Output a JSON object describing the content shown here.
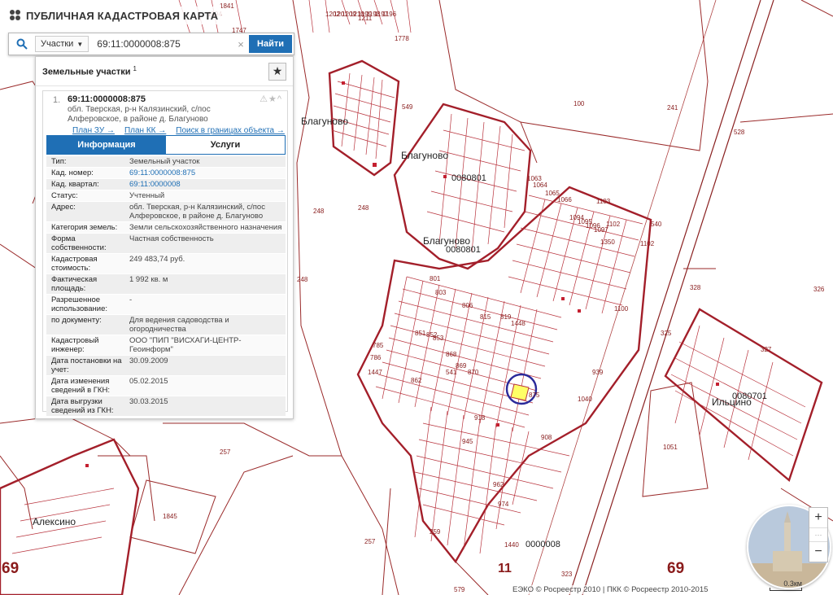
{
  "header": {
    "title": "ПУБЛИЧНАЯ КАДАСТРОВАЯ КАРТА"
  },
  "search": {
    "dropdown_label": "Участки",
    "query": "69:11:0000008:875",
    "clear_symbol": "×",
    "find_label": "Найти"
  },
  "panel": {
    "title": "Земельные участки",
    "count": "1",
    "result": {
      "index": "1.",
      "cad_number": "69:11:0000008:875",
      "address_line1": "обл. Тверская, р-н Калязинский, с/пос",
      "address_line2": "Алферовское, в районе д. Благуново",
      "tools": "⚠★^",
      "links": [
        "План ЗУ →",
        "План КК →",
        "Поиск в границах объекта →"
      ]
    },
    "tabs": [
      {
        "label": "Информация",
        "active": true
      },
      {
        "label": "Услуги",
        "active": false
      }
    ],
    "rows": [
      {
        "key": "Тип:",
        "value": "Земельный участок"
      },
      {
        "key": "Кад. номер:",
        "value": "69:11:0000008:875"
      },
      {
        "key": "Кад. квартал:",
        "value": "69:11:0000008"
      },
      {
        "key": "Статус:",
        "value": "Учтенный"
      },
      {
        "key": "Адрес:",
        "value": "обл. Тверская, р-н Калязинский, с/пос Алферовское, в районе д. Благуново"
      },
      {
        "key": "Категория земель:",
        "value": "Земли сельскохозяйственного назначения"
      },
      {
        "key": "Форма собственности:",
        "value": "Частная собственность"
      },
      {
        "key": "Кадастровая стоимость:",
        "value": "249 483,74 руб."
      },
      {
        "key": "Фактическая площадь:",
        "value": "1 992 кв. м"
      },
      {
        "key": "Разрешенное использование:",
        "value": "-"
      },
      {
        "key": "по документу:",
        "value": "Для ведения садоводства и огородничества"
      },
      {
        "key": "Кадастровый инженер:",
        "value": "ООО \"ПИП \"ВИСХАГИ-ЦЕНТР-Геоинформ\""
      },
      {
        "key": "Дата постановки на учет:",
        "value": "30.09.2009"
      },
      {
        "key": "Дата изменения сведений в ГКН:",
        "value": "05.02.2015"
      },
      {
        "key": "Дата выгрузки сведений из ГКН:",
        "value": "30.03.2015"
      }
    ]
  },
  "map": {
    "labels": {
      "blagunovo_1": "Благуново",
      "blagunovo_2": "Благуново",
      "blagunovo_3": "Благуново",
      "quarter_0080801_a": "0080801",
      "quarter_0080801_b": "0080801",
      "ilitsino": "Ильцино",
      "quarter_0080701": "0080701",
      "aleksino": "Алексино",
      "quarter_0000008": "0000008",
      "district_11": "11",
      "region_69_left": "69",
      "region_69_right": "69"
    },
    "parcel_numbers": [
      "100",
      "241",
      "528",
      "248",
      "248",
      "248",
      "1103",
      "1102",
      "1102",
      "540",
      "1350",
      "328",
      "326",
      "325",
      "327",
      "1448",
      "1100",
      "257",
      "1051",
      "1845",
      "257",
      "259",
      "1440",
      "323",
      "579",
      "549",
      "1778",
      "1747",
      "1841",
      "1894",
      "1202",
      "1201",
      "1199",
      "1198",
      "1197",
      "1196",
      "1209",
      "1210",
      "1211",
      "1094",
      "1095",
      "1096",
      "1097",
      "1064",
      "1065",
      "1066",
      "1063",
      "541",
      "785",
      "786",
      "1447",
      "801",
      "803",
      "806",
      "815",
      "819",
      "851",
      "852",
      "853",
      "868",
      "869",
      "870",
      "875",
      "939",
      "1040",
      "862",
      "908",
      "918",
      "945",
      "962",
      "974"
    ],
    "zoom_plus": "+",
    "zoom_minus": "−",
    "zoom_mid": "···",
    "scale_text": "0.3км",
    "copyright": "ЕЭКО © Росреестр 2010 | ПКК © Росреестр 2010-2015"
  }
}
